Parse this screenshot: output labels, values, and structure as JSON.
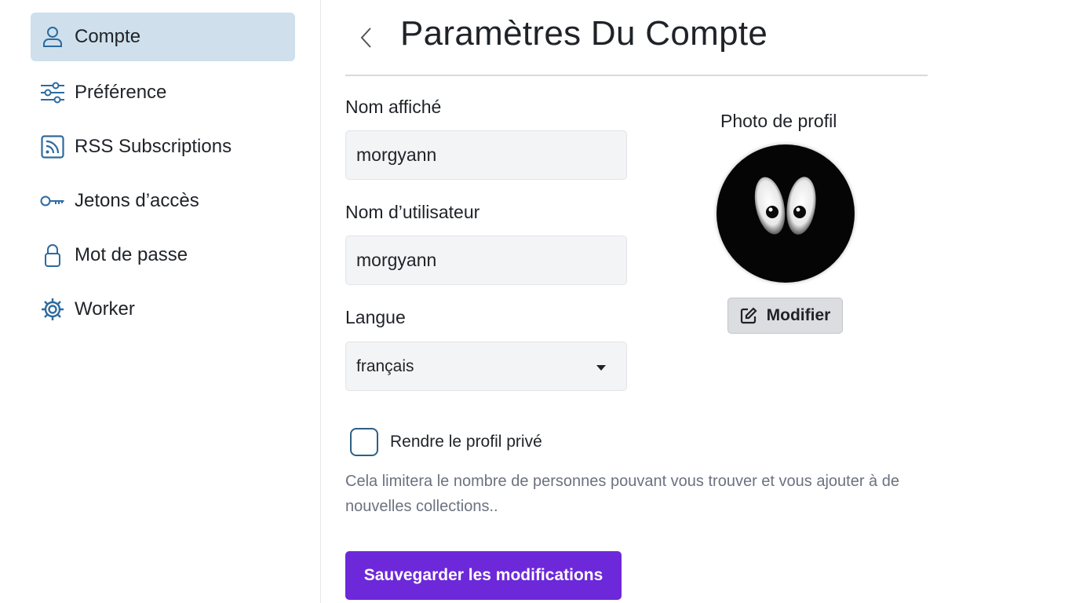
{
  "sidebar": {
    "items": [
      {
        "label": "Compte",
        "icon": "user-icon",
        "active": true
      },
      {
        "label": "Préférence",
        "icon": "sliders-icon",
        "active": false
      },
      {
        "label": "RSS Subscriptions",
        "icon": "rss-icon",
        "active": false
      },
      {
        "label": "Jetons d’accès",
        "icon": "key-icon",
        "active": false
      },
      {
        "label": "Mot de passe",
        "icon": "lock-icon",
        "active": false
      },
      {
        "label": "Worker",
        "icon": "gear-icon",
        "active": false
      }
    ]
  },
  "header": {
    "title": "Paramètres Du Compte",
    "back_icon": "chevron-left-icon"
  },
  "form": {
    "display_name": {
      "label": "Nom affiché",
      "value": "morgyann"
    },
    "username": {
      "label": "Nom d’utilisateur",
      "value": "morgyann"
    },
    "language": {
      "label": "Langue",
      "value": "français"
    },
    "private_profile": {
      "label": "Rendre le profil privé",
      "checked": false,
      "help": "Cela limitera le nombre de personnes pouvant vous trouver et vous ajouter à de nouvelles collections.."
    },
    "save_label": "Sauvegarder les modifications"
  },
  "profile_photo": {
    "label": "Photo de profil",
    "modify_label": "Modifier",
    "modify_icon": "edit-icon"
  },
  "colors": {
    "accent": "#6d28d9",
    "active_nav": "#cfe0ec",
    "icon": "#2d6a9f"
  }
}
